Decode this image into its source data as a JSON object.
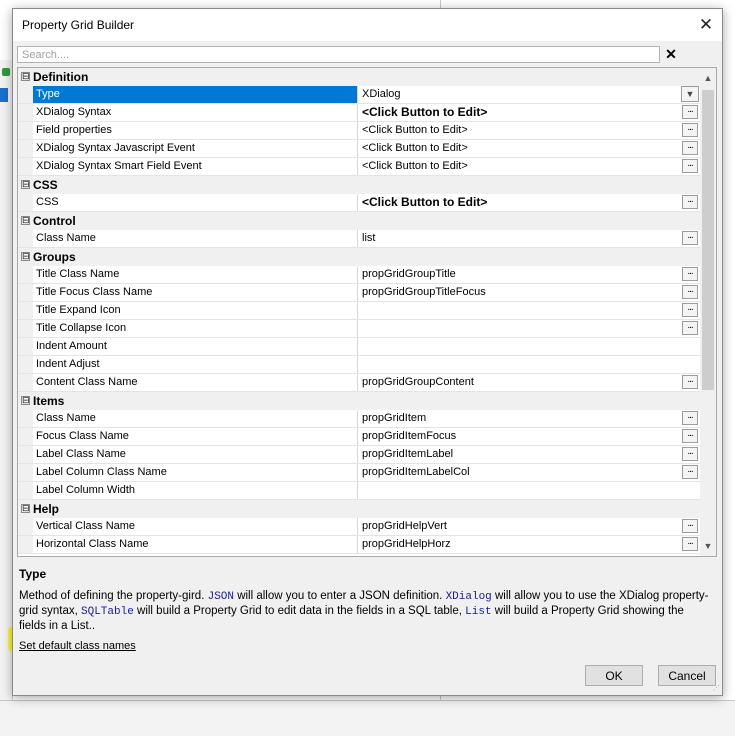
{
  "dialog": {
    "title": "Property Grid Builder",
    "close_glyph": "✕"
  },
  "search": {
    "placeholder": "Search....",
    "value": "",
    "clear_glyph": "✕"
  },
  "grid": {
    "groups": [
      {
        "title": "Definition",
        "toggle": "⊟",
        "rows": [
          {
            "name": "Type",
            "value": "XDialog",
            "button": "dropdown",
            "selected": true,
            "bold": false
          },
          {
            "name": "XDialog Syntax",
            "value": "<Click Button to Edit>",
            "button": "ellipsis",
            "bold": true
          },
          {
            "name": "Field properties",
            "value": "<Click Button to Edit>",
            "button": "ellipsis",
            "bold": false
          },
          {
            "name": "XDialog Syntax Javascript Event",
            "value": "<Click Button to Edit>",
            "button": "ellipsis",
            "bold": false
          },
          {
            "name": "XDialog Syntax Smart Field Event",
            "value": "<Click Button to Edit>",
            "button": "ellipsis",
            "bold": false
          }
        ]
      },
      {
        "title": "CSS",
        "toggle": "⊟",
        "rows": [
          {
            "name": "CSS",
            "value": "<Click Button to Edit>",
            "button": "ellipsis",
            "bold": true
          }
        ]
      },
      {
        "title": "Control",
        "toggle": "⊟",
        "rows": [
          {
            "name": "Class Name",
            "value": "list",
            "button": "ellipsis",
            "bold": false
          }
        ]
      },
      {
        "title": "Groups",
        "toggle": "⊟",
        "rows": [
          {
            "name": "Title Class Name",
            "value": "propGridGroupTitle",
            "button": "ellipsis",
            "bold": false
          },
          {
            "name": "Title Focus Class Name",
            "value": "propGridGroupTitleFocus",
            "button": "ellipsis",
            "bold": false
          },
          {
            "name": "Title Expand Icon",
            "value": "",
            "button": "ellipsis",
            "bold": false
          },
          {
            "name": "Title Collapse Icon",
            "value": "",
            "button": "ellipsis",
            "bold": false
          },
          {
            "name": "Indent Amount",
            "value": "",
            "button": "none",
            "bold": false
          },
          {
            "name": "Indent Adjust",
            "value": "",
            "button": "none",
            "bold": false
          },
          {
            "name": "Content Class Name",
            "value": "propGridGroupContent",
            "button": "ellipsis",
            "bold": false
          }
        ]
      },
      {
        "title": "Items",
        "toggle": "⊟",
        "rows": [
          {
            "name": "Class Name",
            "value": "propGridItem",
            "button": "ellipsis",
            "bold": false
          },
          {
            "name": "Focus Class Name",
            "value": "propGridItemFocus",
            "button": "ellipsis",
            "bold": false
          },
          {
            "name": "Label Class Name",
            "value": "propGridItemLabel",
            "button": "ellipsis",
            "bold": false
          },
          {
            "name": "Label Column Class Name",
            "value": "propGridItemLabelCol",
            "button": "ellipsis",
            "bold": false
          },
          {
            "name": "Label Column Width",
            "value": "",
            "button": "none",
            "bold": false
          }
        ]
      },
      {
        "title": "Help",
        "toggle": "⊟",
        "rows": [
          {
            "name": "Vertical Class Name",
            "value": "propGridHelpVert",
            "button": "ellipsis",
            "bold": false
          },
          {
            "name": "Horizontal Class Name",
            "value": "propGridHelpHorz",
            "button": "ellipsis",
            "bold": false
          }
        ]
      }
    ],
    "ellipsis_glyph": "...",
    "dropdown_glyph": "▼",
    "scroll_up_glyph": "▲",
    "scroll_down_glyph": "▼"
  },
  "help": {
    "title": "Type",
    "segments": [
      {
        "text": "Method of defining the property-gird. ",
        "code": false
      },
      {
        "text": "JSON",
        "code": true
      },
      {
        "text": " will allow you to enter a JSON definition. ",
        "code": false
      },
      {
        "text": "XDialog",
        "code": true
      },
      {
        "text": " will allow you to use the XDialog property-grid syntax, ",
        "code": false
      },
      {
        "text": "SQLTable",
        "code": true
      },
      {
        "text": " will build a Property Grid to edit data in the fields in a SQL table, ",
        "code": false
      },
      {
        "text": "List",
        "code": true
      },
      {
        "text": " will build a Property Grid showing the fields in a List..",
        "code": false
      }
    ],
    "link": "Set default class names"
  },
  "buttons": {
    "ok": "OK",
    "cancel": "Cancel"
  },
  "colors": {
    "selection": "#0078d7",
    "highlighter": "#ffff00",
    "code_text": "#1a1aa6"
  }
}
